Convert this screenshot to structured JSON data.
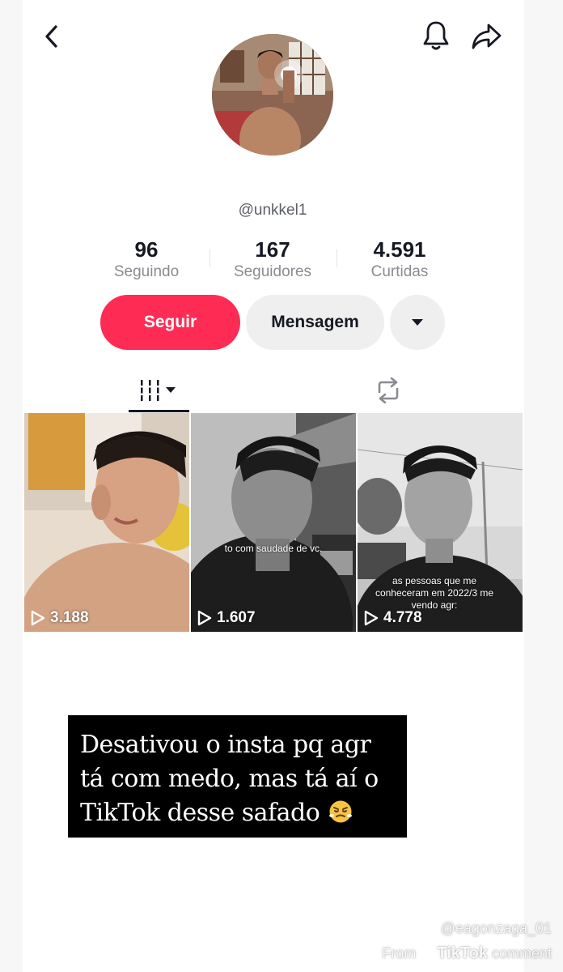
{
  "header": {
    "back_icon": "chevron-left-icon",
    "bell_icon": "bell-icon",
    "share_icon": "share-arrow-icon"
  },
  "profile": {
    "username": "@unkkel1",
    "stats": [
      {
        "value": "96",
        "label": "Seguindo"
      },
      {
        "value": "167",
        "label": "Seguidores"
      },
      {
        "value": "4.591",
        "label": "Curtidas"
      }
    ]
  },
  "actions": {
    "follow_label": "Seguir",
    "message_label": "Mensagem",
    "more_icon": "caret-down-icon"
  },
  "tabs": {
    "videos_icon": "grid-bars-icon",
    "reposts_icon": "repost-icon"
  },
  "videos": [
    {
      "views": "3.188",
      "caption": ""
    },
    {
      "views": "1.607",
      "caption": "to com saudade de vc."
    },
    {
      "views": "4.778",
      "caption": "as pessoas que me conheceram em 2022/3 me vendo agr:"
    }
  ],
  "story": {
    "line1": "Desativou o insta pq agr",
    "line2": "tá com medo, mas tá aí o",
    "line3": "TikTok desse safado"
  },
  "watermark": {
    "user": "@eagonzaga_01",
    "from": "From",
    "brand": "TikTok",
    "suffix": "comment"
  },
  "colors": {
    "follow": "#fe2c55",
    "secondary_button": "#efefef",
    "text": "#161823",
    "muted": "#8a8b91"
  }
}
